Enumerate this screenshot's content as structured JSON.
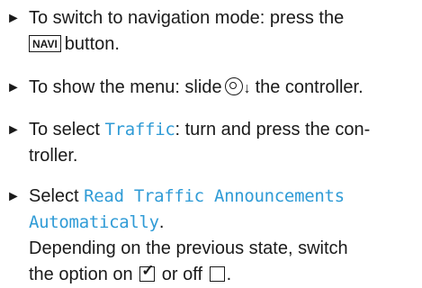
{
  "steps": [
    {
      "line1": "To switch to navigation mode: press the",
      "key": "NAVI",
      "line2_rest": "button."
    },
    {
      "pre": "To show the menu: slide",
      "arrow": "↓",
      "post": "the controller."
    },
    {
      "pre": "To select",
      "mono": "Traffic",
      "post": ": turn and press the con-",
      "line2": "troller."
    },
    {
      "pre": "Select",
      "mono1": "Read Traffic Announcements",
      "mono2": "Automatically",
      "post": ".",
      "line3": "Depending on the previous state, switch",
      "line4_pre": "the option on",
      "line4_mid": "or off",
      "line4_post": ".",
      "check_glyph": "✓"
    }
  ],
  "bullet_glyph": "►",
  "colors": {
    "accent": "#2f9bd6",
    "text": "#1a1a1a"
  }
}
